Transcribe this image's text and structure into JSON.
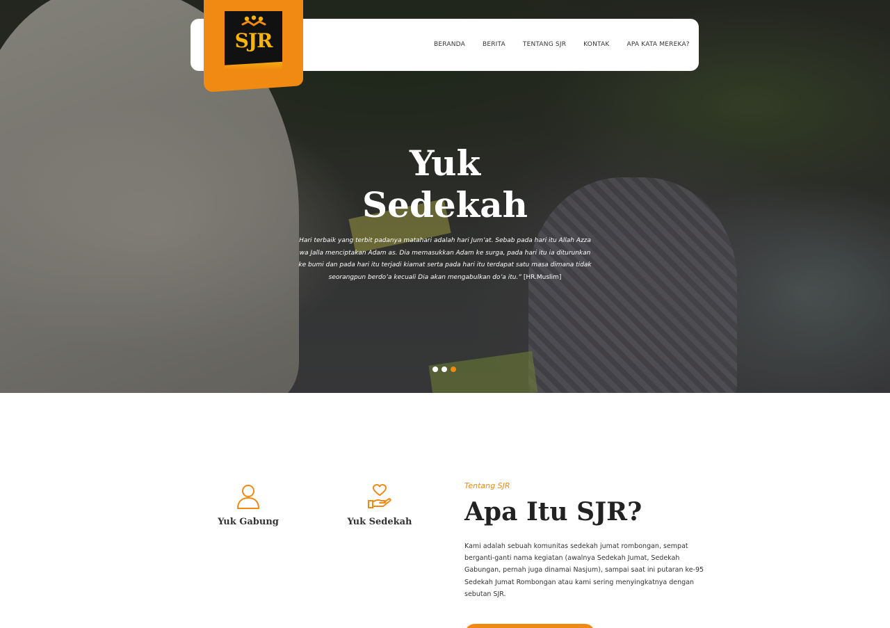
{
  "brand": {
    "logo_text": "SJR",
    "accent": "#f08a12"
  },
  "nav": {
    "items": [
      {
        "label": "BERANDA"
      },
      {
        "label": "BERITA"
      },
      {
        "label": "TENTANG SJR"
      },
      {
        "label": "KONTAK"
      },
      {
        "label": "APA KATA MEREKA?"
      }
    ]
  },
  "hero": {
    "title_line1": "Yuk",
    "title_line2": "Sedekah",
    "quote": "Hari terbaik yang terbit padanya matahari adalah hari Jum’at. Sebab pada hari itu Allah Azza wa Jalla menciptakan Adam as. Dia memasukkan Adam ke surga, pada hari itu ia diturunkan ke bumi dan pada hari itu terjadi kiamat serta pada hari itu terdapat satu masa dimana tidak seorangpun berdo’a kecuali Dia akan mengabulkan do’a itu.”",
    "quote_source": "[HR.Muslim]",
    "slides_total": 3,
    "active_slide": 3
  },
  "features": [
    {
      "label": "Yuk Gabung",
      "icon": "user-icon"
    },
    {
      "label": "Yuk Sedekah",
      "icon": "heart-hand-icon"
    }
  ],
  "about": {
    "eyebrow": "Tentang SJR",
    "title": "Apa Itu SJR?",
    "text": "Kami adalah sebuah komunitas sedekah jumat rombongan, sempat berganti-ganti nama kegiatan (awalnya Sedekah Jumat, Sedekah Gabungan, pernah juga dinamai Nasjum), sampai saat ini putaran ke-95 Sedekah Jumat Rombongan atau kami sering menyingkatnya dengan sebutan SJR."
  }
}
